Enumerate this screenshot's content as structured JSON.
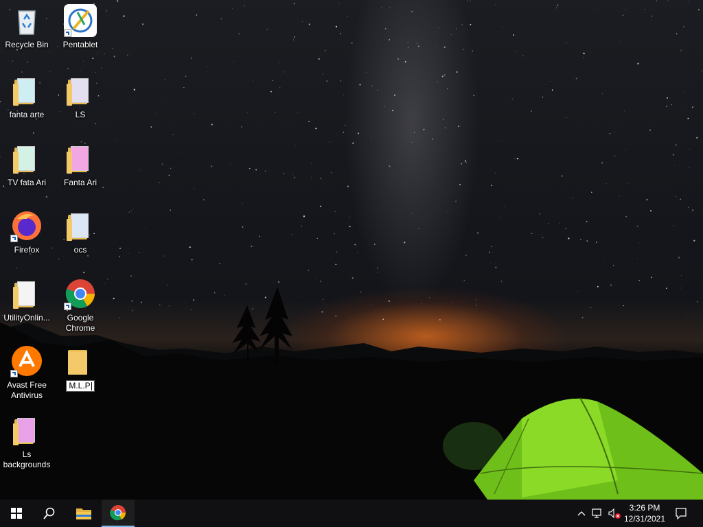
{
  "desktop": {
    "icons": [
      {
        "name": "recycle-bin",
        "label": "Recycle Bin"
      },
      {
        "name": "pentablet",
        "label": "Pentablet"
      },
      {
        "name": "fanta-arte",
        "label": "fanta arte"
      },
      {
        "name": "ls",
        "label": "LS"
      },
      {
        "name": "tv-fata-ari",
        "label": "TV  fata Ari"
      },
      {
        "name": "fanta-ari",
        "label": "Fanta Ari"
      },
      {
        "name": "firefox",
        "label": "Firefox"
      },
      {
        "name": "ocs",
        "label": "ocs"
      },
      {
        "name": "utilityonline",
        "label": "UtilityOnlin..."
      },
      {
        "name": "google-chrome",
        "label": "Google Chrome"
      },
      {
        "name": "avast-free-antivirus",
        "label": "Avast Free Antivirus"
      },
      {
        "name": "mlp",
        "label": "M.L.P"
      },
      {
        "name": "ls-backgrounds",
        "label": "Ls backgrounds"
      }
    ]
  },
  "taskbar": {
    "start_icon": "windows-logo",
    "search_icon": "search-icon",
    "pinned": [
      {
        "name": "file-explorer",
        "icon": "folder-icon"
      },
      {
        "name": "google-chrome",
        "icon": "chrome-icon",
        "active": true
      }
    ],
    "tray": {
      "show_hidden_icon": "chevron-up-icon",
      "network_icon": "network-icon",
      "volume_icon": "volume-muted-icon"
    },
    "clock": {
      "time": "3:26 PM",
      "date": "12/31/2021"
    },
    "notification_icon": "action-center-icon"
  },
  "colors": {
    "taskbar_bg": "#101012",
    "active_indicator": "#76b9ed",
    "tent": "#7ed321"
  }
}
